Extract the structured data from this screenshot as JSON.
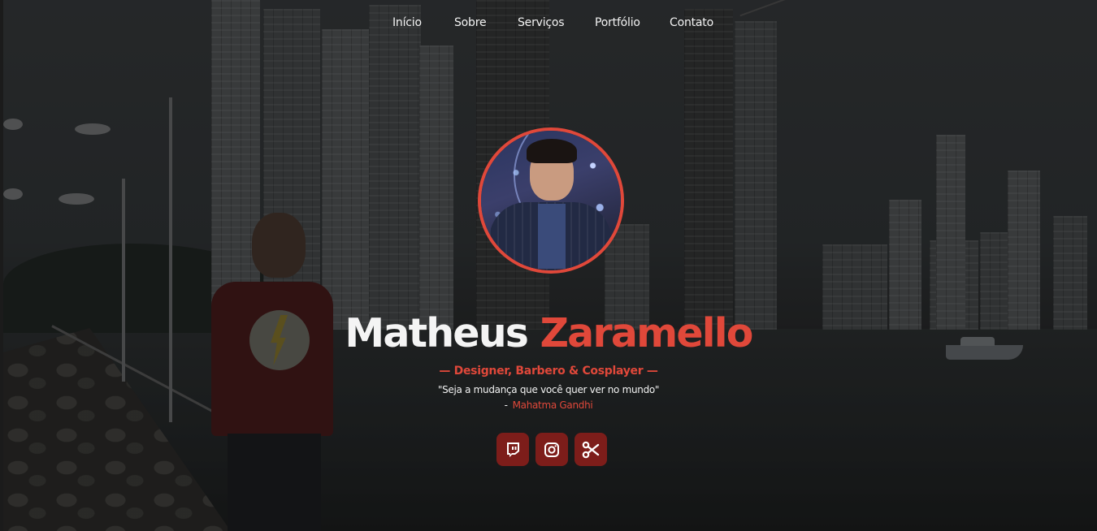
{
  "nav": {
    "items": [
      {
        "label": "Início"
      },
      {
        "label": "Sobre"
      },
      {
        "label": "Serviços"
      },
      {
        "label": "Portfólio"
      },
      {
        "label": "Contato"
      }
    ]
  },
  "hero": {
    "name_first": "Matheus",
    "name_last": "Zaramello",
    "subtitle": "— Designer,  Barbero & Cosplayer —",
    "quote": "\"Seja a mudança que você quer ver no mundo\"",
    "author_dash": "-",
    "author": "Mahatma Gandhi"
  },
  "socials": [
    {
      "icon": "twitch-icon"
    },
    {
      "icon": "instagram-icon"
    },
    {
      "icon": "scissors-icon"
    }
  ],
  "colors": {
    "accent": "#e0483a",
    "button_bg": "#7d1d1a",
    "text": "#f4f4f4"
  }
}
